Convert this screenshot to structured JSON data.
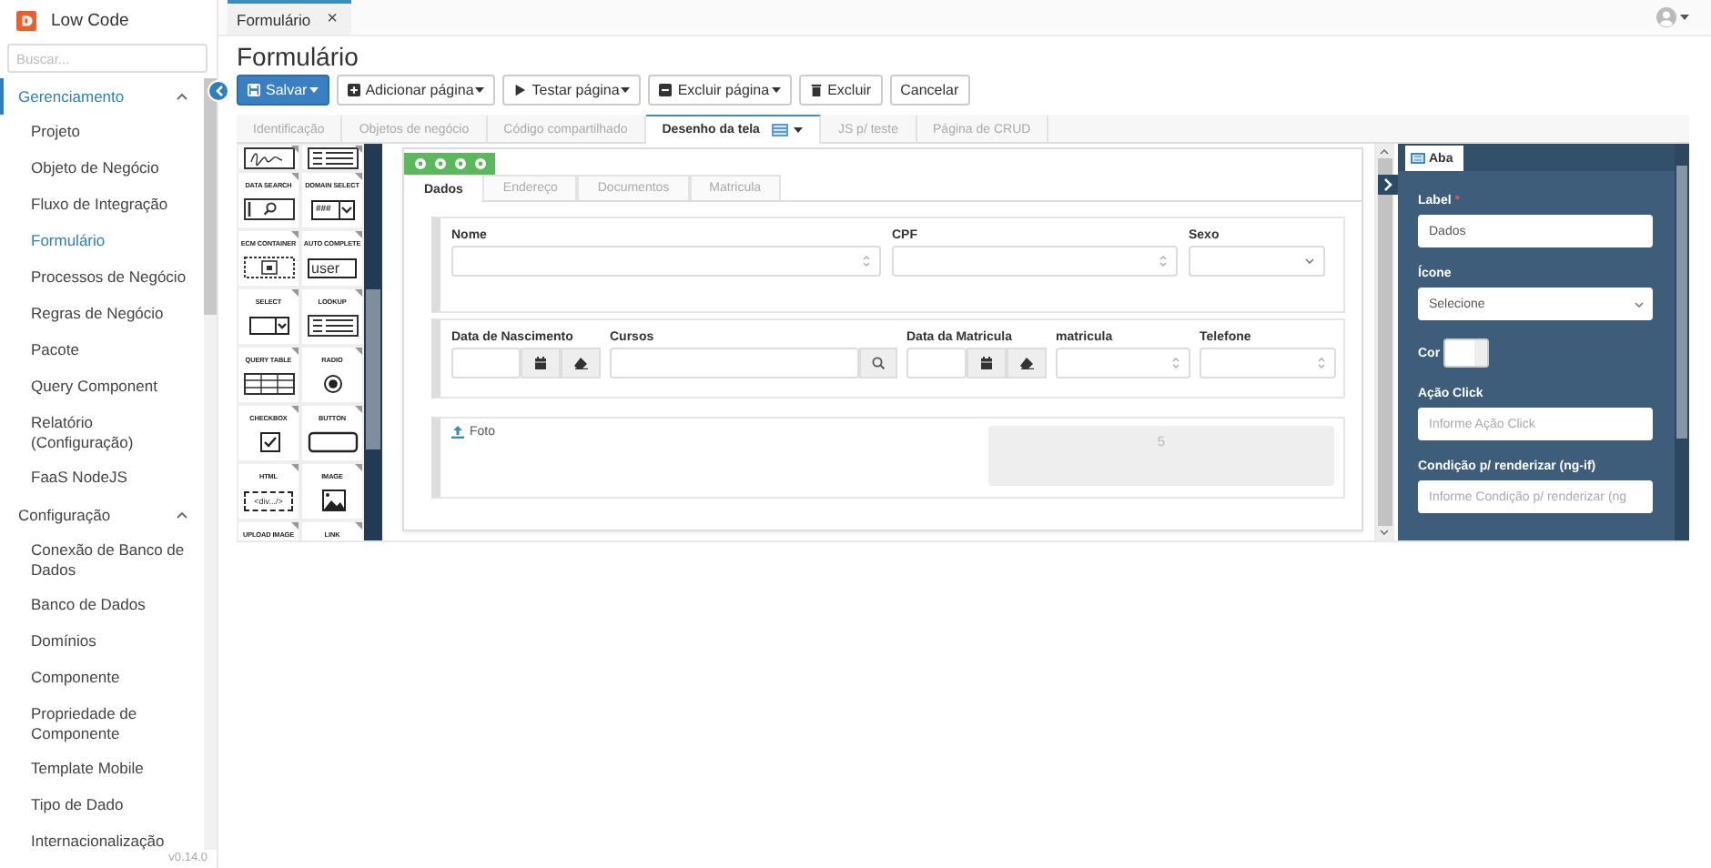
{
  "app": {
    "title": "Low Code"
  },
  "search": {
    "placeholder": "Buscar..."
  },
  "nav": [
    {
      "label": "Gerenciamento",
      "active": true,
      "expanded": true,
      "children": [
        {
          "label": "Projeto",
          "selected": false
        },
        {
          "label": "Objeto de Negócio",
          "selected": false
        },
        {
          "label": "Fluxo de Integração",
          "selected": false
        },
        {
          "label": "Formulário",
          "selected": true
        },
        {
          "label": "Processos de Negócio",
          "selected": false
        },
        {
          "label": "Regras de Negócio",
          "selected": false
        },
        {
          "label": "Pacote",
          "selected": false
        },
        {
          "label": "Query Component",
          "selected": false
        },
        {
          "label": "Relatório (Configuração)",
          "selected": false
        },
        {
          "label": "FaaS NodeJS",
          "selected": false
        }
      ]
    },
    {
      "label": "Configuração",
      "active": false,
      "expanded": true,
      "children": [
        {
          "label": "Conexão de Banco de Dados",
          "selected": false
        },
        {
          "label": "Banco de Dados",
          "selected": false
        },
        {
          "label": "Domínios",
          "selected": false
        },
        {
          "label": "Componente",
          "selected": false
        },
        {
          "label": "Propriedade de Componente",
          "selected": false
        },
        {
          "label": "Template Mobile",
          "selected": false
        },
        {
          "label": "Tipo de Dado",
          "selected": false
        },
        {
          "label": "Internacionalização",
          "selected": false
        }
      ]
    }
  ],
  "version": "v0.14.0",
  "open_tabs": [
    {
      "label": "Formulário",
      "close": "×",
      "selected": true
    }
  ],
  "page_title": "Formulário",
  "buttons": [
    {
      "label": "Salvar",
      "kind": "save",
      "primary": true,
      "dropdown": true
    },
    {
      "label": "Adicionar página",
      "kind": "add",
      "primary": false,
      "dropdown": true
    },
    {
      "label": "Testar página",
      "kind": "play",
      "primary": false,
      "dropdown": true
    },
    {
      "label": "Excluir página",
      "kind": "remove",
      "primary": false,
      "dropdown": true
    },
    {
      "label": "Excluir",
      "kind": "trash",
      "primary": false,
      "dropdown": false
    },
    {
      "label": "Cancelar",
      "kind": "plain",
      "primary": false,
      "dropdown": false
    }
  ],
  "tabs": [
    {
      "label": "Identificação",
      "selected": false,
      "menu": false
    },
    {
      "label": "Objetos de negócio",
      "selected": false,
      "menu": false
    },
    {
      "label": "Código compartilhado",
      "selected": false,
      "menu": false
    },
    {
      "label": "Desenho da tela",
      "selected": true,
      "menu": true
    },
    {
      "label": "JS p/ teste",
      "selected": false,
      "menu": false
    },
    {
      "label": "Página de CRUD",
      "selected": false,
      "menu": false
    }
  ],
  "palette": [
    {
      "kind": "signature"
    },
    {
      "kind": "list"
    },
    {
      "label": "DATA SEARCH",
      "kind": "search"
    },
    {
      "label": "DOMAIN SELECT",
      "kind": "domain",
      "sample": "###"
    },
    {
      "label": "ECM CONTAINER",
      "kind": "container"
    },
    {
      "label": "AUTO COMPLETE",
      "kind": "autocomplete",
      "sample": "user"
    },
    {
      "label": "SELECT",
      "kind": "select"
    },
    {
      "label": "LOOKUP",
      "kind": "list"
    },
    {
      "label": "QUERY TABLE",
      "kind": "table"
    },
    {
      "label": "RADIO",
      "kind": "radio"
    },
    {
      "label": "CHECKBOX",
      "kind": "checkbox"
    },
    {
      "label": "BUTTON",
      "kind": "button"
    },
    {
      "label": "HTML",
      "kind": "html",
      "sample": "<div.../>"
    },
    {
      "label": "IMAGE",
      "kind": "image"
    },
    {
      "label": "UPLOAD IMAGE",
      "kind": "upload"
    },
    {
      "label": "LINK",
      "kind": "link"
    }
  ],
  "canvas": {
    "tabs": [
      {
        "label": "Dados",
        "selected": true
      },
      {
        "label": "Endereço",
        "selected": false
      },
      {
        "label": "Documentos",
        "selected": false
      },
      {
        "label": "Matricula",
        "selected": false
      }
    ],
    "rows": [
      {
        "fields": [
          {
            "label": "Nome",
            "kind": "number"
          },
          {
            "label": "CPF",
            "kind": "number"
          },
          {
            "label": "Sexo",
            "kind": "select"
          }
        ]
      },
      {
        "fields": [
          {
            "label": "Data de Nascimento",
            "kind": "date"
          },
          {
            "label": "Cursos",
            "kind": "lookup"
          },
          {
            "label": "Data da Matricula",
            "kind": "date"
          },
          {
            "label": "matricula",
            "kind": "number"
          },
          {
            "label": "Telefone",
            "kind": "number"
          }
        ]
      }
    ],
    "upload": {
      "label": "Foto",
      "preview": "5"
    }
  },
  "properties": {
    "tab": "Aba",
    "fields": [
      {
        "label": "Label",
        "required_mark": "*",
        "kind": "text",
        "value": "Dados"
      },
      {
        "label": "Ícone",
        "kind": "select",
        "value": "Selecione"
      },
      {
        "label": "Cor",
        "kind": "color"
      },
      {
        "label": "Ação Click",
        "kind": "text",
        "placeholder": "Informe Ação Click"
      },
      {
        "label": "Condição p/ renderizar (ng-if)",
        "kind": "text",
        "placeholder": "Informe Condição p/ renderizar (ng"
      }
    ]
  }
}
